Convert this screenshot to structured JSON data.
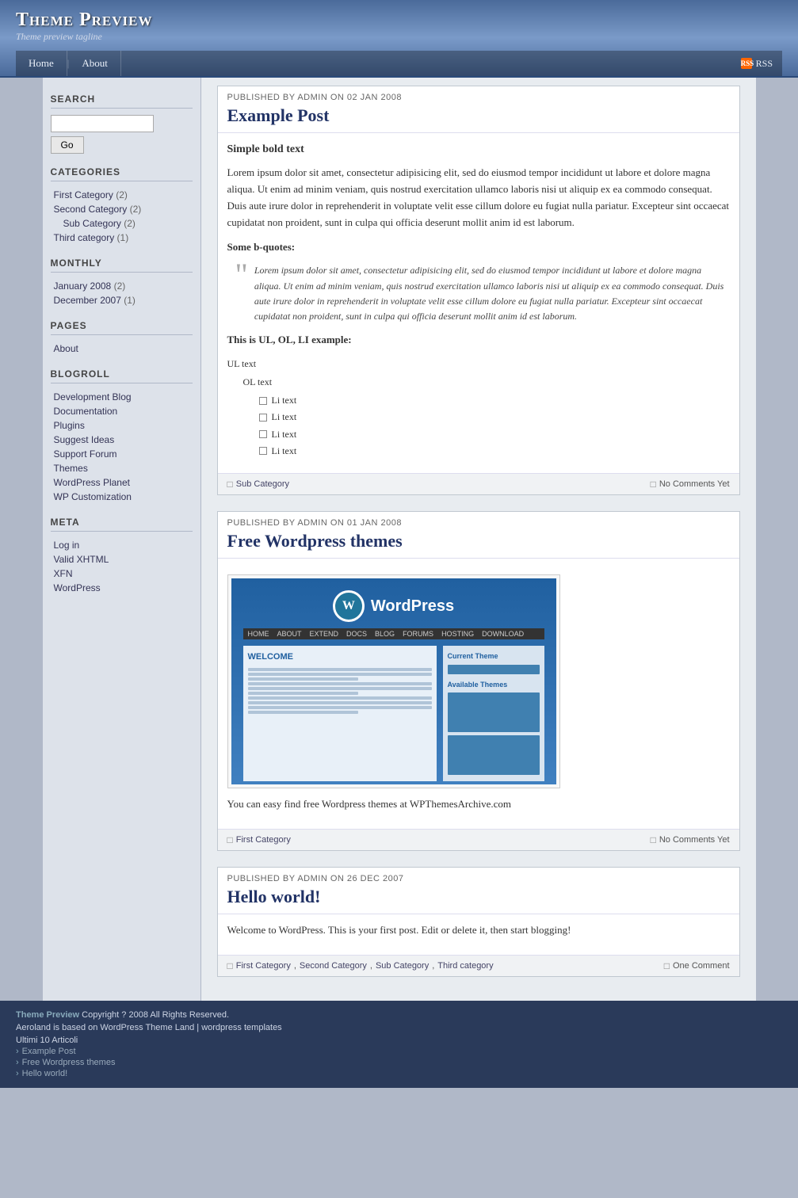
{
  "header": {
    "title": "Theme Preview",
    "tagline": "Theme preview tagline",
    "nav": [
      {
        "label": "Home",
        "id": "home"
      },
      {
        "label": "About",
        "id": "about"
      }
    ],
    "rss_label": "RSS"
  },
  "sidebar": {
    "search_label": "SEARCH",
    "search_placeholder": "",
    "go_label": "Go",
    "categories_label": "CATEGORIES",
    "categories": [
      {
        "label": "First Category",
        "count": "(2)",
        "sub": false
      },
      {
        "label": "Second Category",
        "count": "(2)",
        "sub": false
      },
      {
        "label": "Sub Category",
        "count": "(2)",
        "sub": true
      },
      {
        "label": "Third category",
        "count": "(1)",
        "sub": false
      }
    ],
    "monthly_label": "MONTHLY",
    "monthly": [
      {
        "label": "January 2008",
        "count": "(2)"
      },
      {
        "label": "December 2007",
        "count": "(1)"
      }
    ],
    "pages_label": "PAGES",
    "pages": [
      {
        "label": "About"
      }
    ],
    "blogroll_label": "BLOGROLL",
    "blogroll": [
      {
        "label": "Development Blog"
      },
      {
        "label": "Documentation"
      },
      {
        "label": "Plugins"
      },
      {
        "label": "Suggest Ideas"
      },
      {
        "label": "Support Forum"
      },
      {
        "label": "Themes"
      },
      {
        "label": "WordPress Planet"
      },
      {
        "label": "WP Customization"
      }
    ],
    "meta_label": "META",
    "meta": [
      {
        "label": "Log in"
      },
      {
        "label": "Valid XHTML"
      },
      {
        "label": "XFN"
      },
      {
        "label": "WordPress"
      }
    ]
  },
  "posts": [
    {
      "meta": "Published by admin on 02 Jan 2008",
      "title": "Example Post",
      "subtitle": "Simple bold text",
      "body_para": "Lorem ipsum dolor sit amet, consectetur adipisicing elit, sed do eiusmod tempor incididunt ut labore et dolore magna aliqua. Ut enim ad minim veniam, quis nostrud exercitation ullamco laboris nisi ut aliquip ex ea commodo consequat. Duis aute irure dolor in reprehenderit in voluptate velit esse cillum dolore eu fugiat nulla pariatur. Excepteur sint occaecat cupidatat non proident, sunt in culpa qui officia deserunt mollit anim id est laborum.",
      "blockquote_label": "Some b-quotes:",
      "blockquote": "Lorem ipsum dolor sit amet, consectetur adipisicing elit, sed do eiusmod tempor incididunt ut labore et dolore magna aliqua. Ut enim ad minim veniam, quis nostrud exercitation ullamco laboris nisi ut aliquip ex ea commodo consequat. Duis aute irure dolor in reprehenderit in voluptate velit esse cillum dolore eu fugiat nulla pariatur. Excepteur sint occaecat cupidatat non proident, sunt in culpa qui officia deserunt mollit anim id est laborum.",
      "list_label": "This is UL, OL, LI example:",
      "ul_text": "UL text",
      "ol_text": "OL text",
      "li_items": [
        "Li text",
        "Li text",
        "Li text",
        "Li text"
      ],
      "cat": "Sub Category",
      "comments": "No Comments Yet"
    },
    {
      "meta": "Published by admin on 01 Jan 2008",
      "title": "Free Wordpress themes",
      "body_para": "You can easy find free Wordpress themes at WPThemesArchive.com",
      "cat": "First Category",
      "comments": "No Comments Yet",
      "has_image": true
    },
    {
      "meta": "Published by admin on 26 Dec 2007",
      "title": "Hello world!",
      "body_para": "Welcome to WordPress. This is your first post. Edit or delete it, then start blogging!",
      "cats": [
        "First Category",
        "Second Category",
        "Sub Category",
        "Third category"
      ],
      "comments": "One Comment"
    }
  ],
  "footer": {
    "brand": "Theme Preview",
    "copyright": "Copyright ? 2008 All Rights Reserved.",
    "credit": "Aeroland is based on WordPress Theme Land | wordpress templates",
    "links_title": "Ultimi 10 Articoli",
    "links": [
      "Example Post",
      "Free Wordpress themes",
      "Hello world!"
    ]
  },
  "wp_mock": {
    "logo_text": "W",
    "brand": "WordPress",
    "nav_items": [
      "HOME",
      "ABOUT",
      "EXTEND",
      "DOCS",
      "BLOG",
      "FORUMS",
      "HOSTING",
      "DOWNLOAD"
    ],
    "welcome": "WELCOME",
    "sidebar_title": "Current Theme",
    "sidebar_items": [
      "Available Themes"
    ]
  }
}
